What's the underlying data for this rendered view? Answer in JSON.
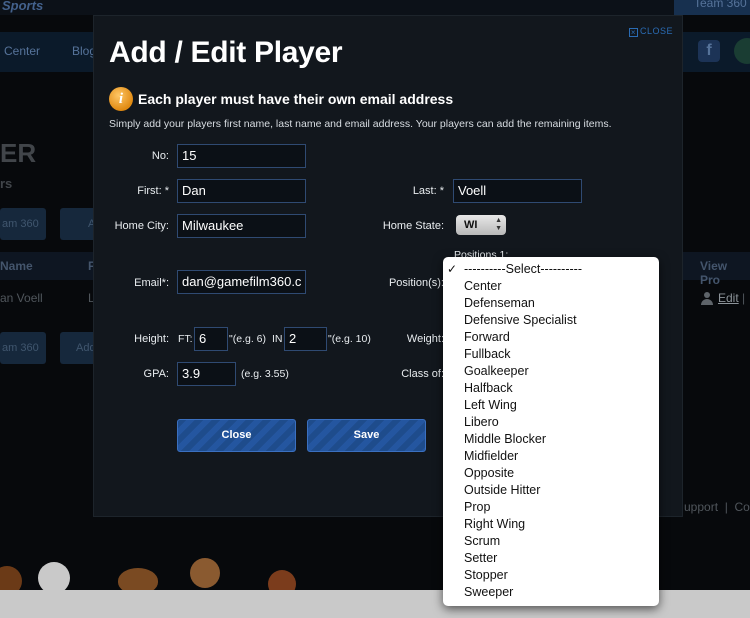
{
  "background": {
    "brand": "Sports",
    "team_tab": "Team 360",
    "nav": [
      "Center",
      "Blog"
    ],
    "page_title_partial": "ER",
    "page_subtitle_partial": "rs",
    "buttons": [
      "am 360",
      "A",
      "am 360",
      "Add"
    ],
    "table_headers": [
      "Name",
      "F",
      "View Pro"
    ],
    "row_name": "an Voell",
    "row_col2": "L",
    "edit_link": "Edit",
    "edit_sep": "|",
    "footer": "upport  |  Co"
  },
  "modal": {
    "close_label": "CLOSE",
    "title": "Add / Edit Player",
    "subtitle": "Each player must have their own email address",
    "help_text": "Simply add your players first name, last name and email address. Your players can add the remaining items.",
    "fields": {
      "no": {
        "label": "No:",
        "value": "15"
      },
      "first": {
        "label": "First: *",
        "value": "Dan"
      },
      "last": {
        "label": "Last: *",
        "value": "Voell"
      },
      "home_city": {
        "label": "Home City:",
        "value": "Milwaukee"
      },
      "home_state": {
        "label": "Home State:",
        "value": "WI"
      },
      "email": {
        "label": "Email*:",
        "value": "dan@gamefilm360.c"
      },
      "positions_header": "Positions 1:",
      "positions": {
        "label": "Position(s):"
      },
      "height": {
        "label": "Height:",
        "ft_label": "FT:",
        "ft_value": "6",
        "ft_hint": "\"(e.g. 6)",
        "in_label": "IN",
        "in_value": "2",
        "in_hint": "\"(e.g. 10)"
      },
      "weight": {
        "label": "Weight:"
      },
      "gpa": {
        "label": "GPA:",
        "value": "3.9",
        "hint": "(e.g. 3.55)"
      },
      "class_of": {
        "label": "Class of:"
      }
    },
    "buttons": {
      "close": "Close",
      "save": "Save"
    }
  },
  "dropdown": {
    "selected_check": "✓",
    "options": [
      "----------Select----------",
      "Center",
      "Defenseman",
      "Defensive Specialist",
      "Forward",
      "Fullback",
      "Goalkeeper",
      "Halfback",
      "Left Wing",
      "Libero",
      "Middle Blocker",
      "Midfielder",
      "Opposite",
      "Outside Hitter",
      "Prop",
      "Right Wing",
      "Scrum",
      "Setter",
      "Stopper",
      "Sweeper"
    ]
  }
}
